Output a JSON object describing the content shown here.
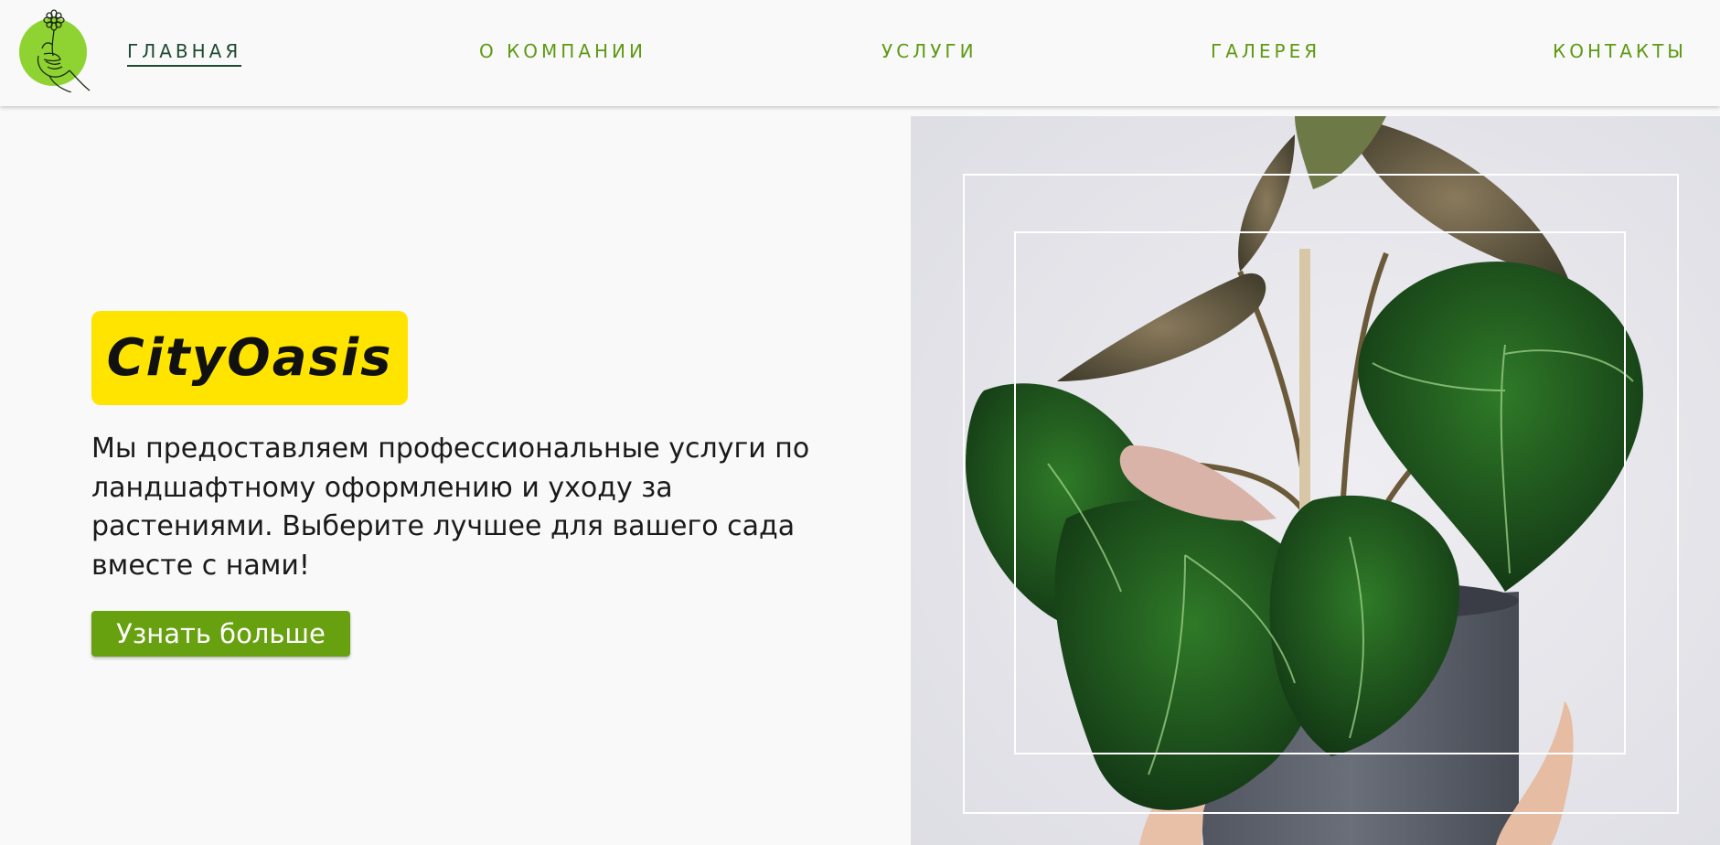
{
  "header": {
    "logo_icon": "flower-in-hand-logo",
    "nav": [
      {
        "label": "ГЛАВНАЯ",
        "active": true
      },
      {
        "label": "О КОМПАНИИ",
        "active": false
      },
      {
        "label": "УСЛУГИ",
        "active": false
      },
      {
        "label": "ГАЛЕРЕЯ",
        "active": false
      },
      {
        "label": "КОНТАКТЫ",
        "active": false
      }
    ]
  },
  "hero": {
    "brand": "CityOasis",
    "description": "Мы предоставляем профессиональные услуги по ландшафтному оформлению и уходу за растениями. Выберите лучшее для вашего сада вместе с нами!",
    "cta_label": "Узнать больше",
    "image_subject": "potted-plant-photo"
  },
  "colors": {
    "nav_text": "#5e9a12",
    "nav_active": "#1f4a33",
    "logo_circle": "#8fd332",
    "brand_badge": "#ffe400",
    "cta_bg": "#68a10f",
    "background": "#f9f9fa"
  }
}
